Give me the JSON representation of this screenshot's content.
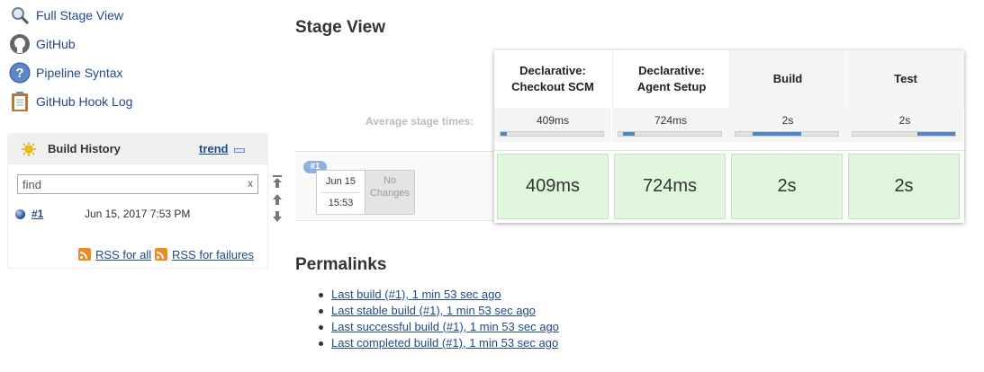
{
  "nav": [
    {
      "label": "Full Stage View",
      "icon": "magnifier-icon"
    },
    {
      "label": "GitHub",
      "icon": "github-icon"
    },
    {
      "label": "Pipeline Syntax",
      "icon": "help-icon"
    },
    {
      "label": "GitHub Hook Log",
      "icon": "clipboard-icon"
    }
  ],
  "build_history": {
    "title": "Build History",
    "trend_label": "trend",
    "search": {
      "placeholder": "find",
      "clear": "x"
    },
    "builds": [
      {
        "number": "#1",
        "date": "Jun 15, 2017 7:53 PM"
      }
    ],
    "rss_all": "RSS for all",
    "rss_failures": "RSS for failures"
  },
  "stage_view": {
    "title": "Stage View",
    "avg_label": "Average stage times:",
    "stages": [
      {
        "name_line1": "Declarative:",
        "name_line2": "Checkout SCM",
        "avg": "409ms",
        "avg_fraction_start": 0.0,
        "avg_fraction_width": 0.06,
        "run": "409ms"
      },
      {
        "name_line1": "Declarative:",
        "name_line2": "Agent Setup",
        "avg": "724ms",
        "avg_fraction_start": 0.04,
        "avg_fraction_width": 0.12,
        "run": "724ms"
      },
      {
        "name_line1": "",
        "name_line2": "Build",
        "avg": "2s",
        "avg_fraction_start": 0.17,
        "avg_fraction_width": 0.47,
        "run": "2s"
      },
      {
        "name_line1": "",
        "name_line2": "Test",
        "avg": "2s",
        "avg_fraction_start": 0.63,
        "avg_fraction_width": 0.37,
        "run": "2s"
      }
    ],
    "run": {
      "badge": "#1",
      "date": "Jun 15",
      "time": "15:53",
      "no_changes_line1": "No",
      "no_changes_line2": "Changes"
    },
    "colors": {
      "success_cell": "#e0f7de",
      "avg_bar": "#4a86d0"
    }
  },
  "permalinks": {
    "title": "Permalinks",
    "links": [
      "Last build (#1), 1 min 53 sec ago",
      "Last stable build (#1), 1 min 53 sec ago",
      "Last successful build (#1), 1 min 53 sec ago",
      "Last completed build (#1), 1 min 53 sec ago"
    ]
  }
}
